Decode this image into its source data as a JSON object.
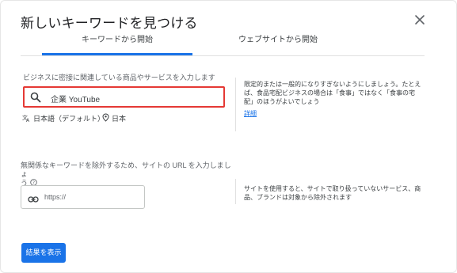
{
  "dialog": {
    "title": "新しいキーワードを見つける",
    "close_icon": "close-icon"
  },
  "tabs": [
    {
      "label": "キーワードから開始",
      "active": true
    },
    {
      "label": "ウェブサイトから開始",
      "active": false
    }
  ],
  "keywords": {
    "label": "ビジネスに密接に関連している商品やサービスを入力します",
    "value": "企業 YouTube",
    "icon": "search-icon",
    "language": "日本語（デフォルト）",
    "location": "日本",
    "hint": "限定的または一般的になりすぎないようにしましょう。たとえば、食品宅配ビジネスの場合は「食事」ではなく「食事の宅配」のほうがよいでしょう",
    "hint_link": "詳細"
  },
  "url_filter": {
    "label_line1": "無関係なキーワードを除外するため、サイトの URL を入力しましょ",
    "label_line2": "う",
    "placeholder": "https://",
    "icon": "link-icon",
    "hint": "サイトを使用すると、サイトで取り扱っていないサービス、商品、ブランドは対象から除外されます"
  },
  "submit_button": "結果を表示",
  "colors": {
    "accent": "#1a73e8",
    "highlight_border": "#e53935"
  }
}
